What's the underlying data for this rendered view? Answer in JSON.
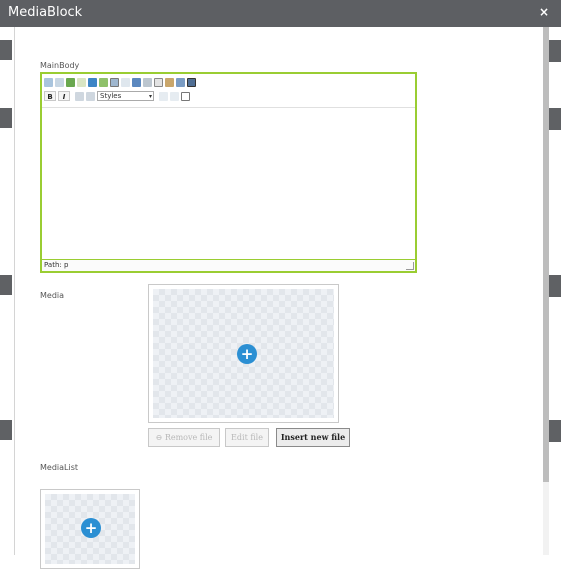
{
  "dialog": {
    "title": "MediaBlock",
    "close_icon": "×"
  },
  "main_body": {
    "label": "MainBody",
    "toolbar_row2": {
      "bold": "B",
      "italic": "I",
      "styles": "Styles"
    },
    "status_path": "Path: p"
  },
  "media": {
    "label": "Media",
    "remove_file": "⊖ Remove file",
    "edit_file": "Edit file",
    "insert_new_file": "Insert new file"
  },
  "media_list": {
    "label": "MediaList"
  },
  "colors": {
    "accent_border": "#9acd32",
    "plus_icon": "#2b8fd3",
    "titlebar": "#5d5f63"
  }
}
